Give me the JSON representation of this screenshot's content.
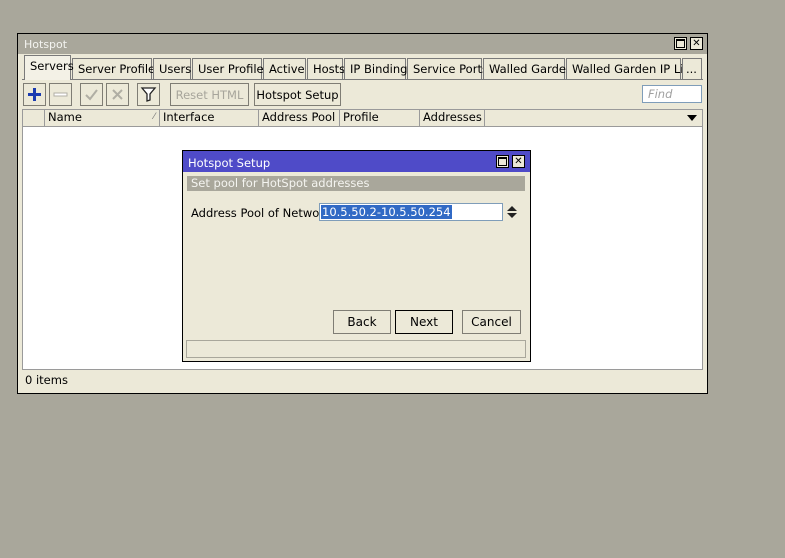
{
  "window": {
    "title": "Hotspot",
    "tabs": [
      {
        "label": "Servers"
      },
      {
        "label": "Server Profiles"
      },
      {
        "label": "Users"
      },
      {
        "label": "User Profiles"
      },
      {
        "label": "Active"
      },
      {
        "label": "Hosts"
      },
      {
        "label": "IP Bindings"
      },
      {
        "label": "Service Ports"
      },
      {
        "label": "Walled Garden"
      },
      {
        "label": "Walled Garden IP List"
      },
      {
        "label": "..."
      }
    ],
    "toolbar": {
      "reset_html": "Reset HTML",
      "hotspot_setup": "Hotspot Setup",
      "find_placeholder": "Find"
    },
    "columns": [
      "Name",
      "Interface",
      "Address Pool",
      "Profile",
      "Addresses ..."
    ],
    "status": "0 items"
  },
  "dialog": {
    "title": "Hotspot Setup",
    "subtitle": "Set pool for HotSpot addresses",
    "field_label": "Address Pool of Network:",
    "field_value": "10.5.50.2-10.5.50.254",
    "back": "Back",
    "next": "Next",
    "cancel": "Cancel"
  },
  "colors": {
    "desktop": "#a9a79b",
    "window_bg": "#ece9d8",
    "dialog_title": "#4f4bc8",
    "selection": "#316ac5"
  }
}
